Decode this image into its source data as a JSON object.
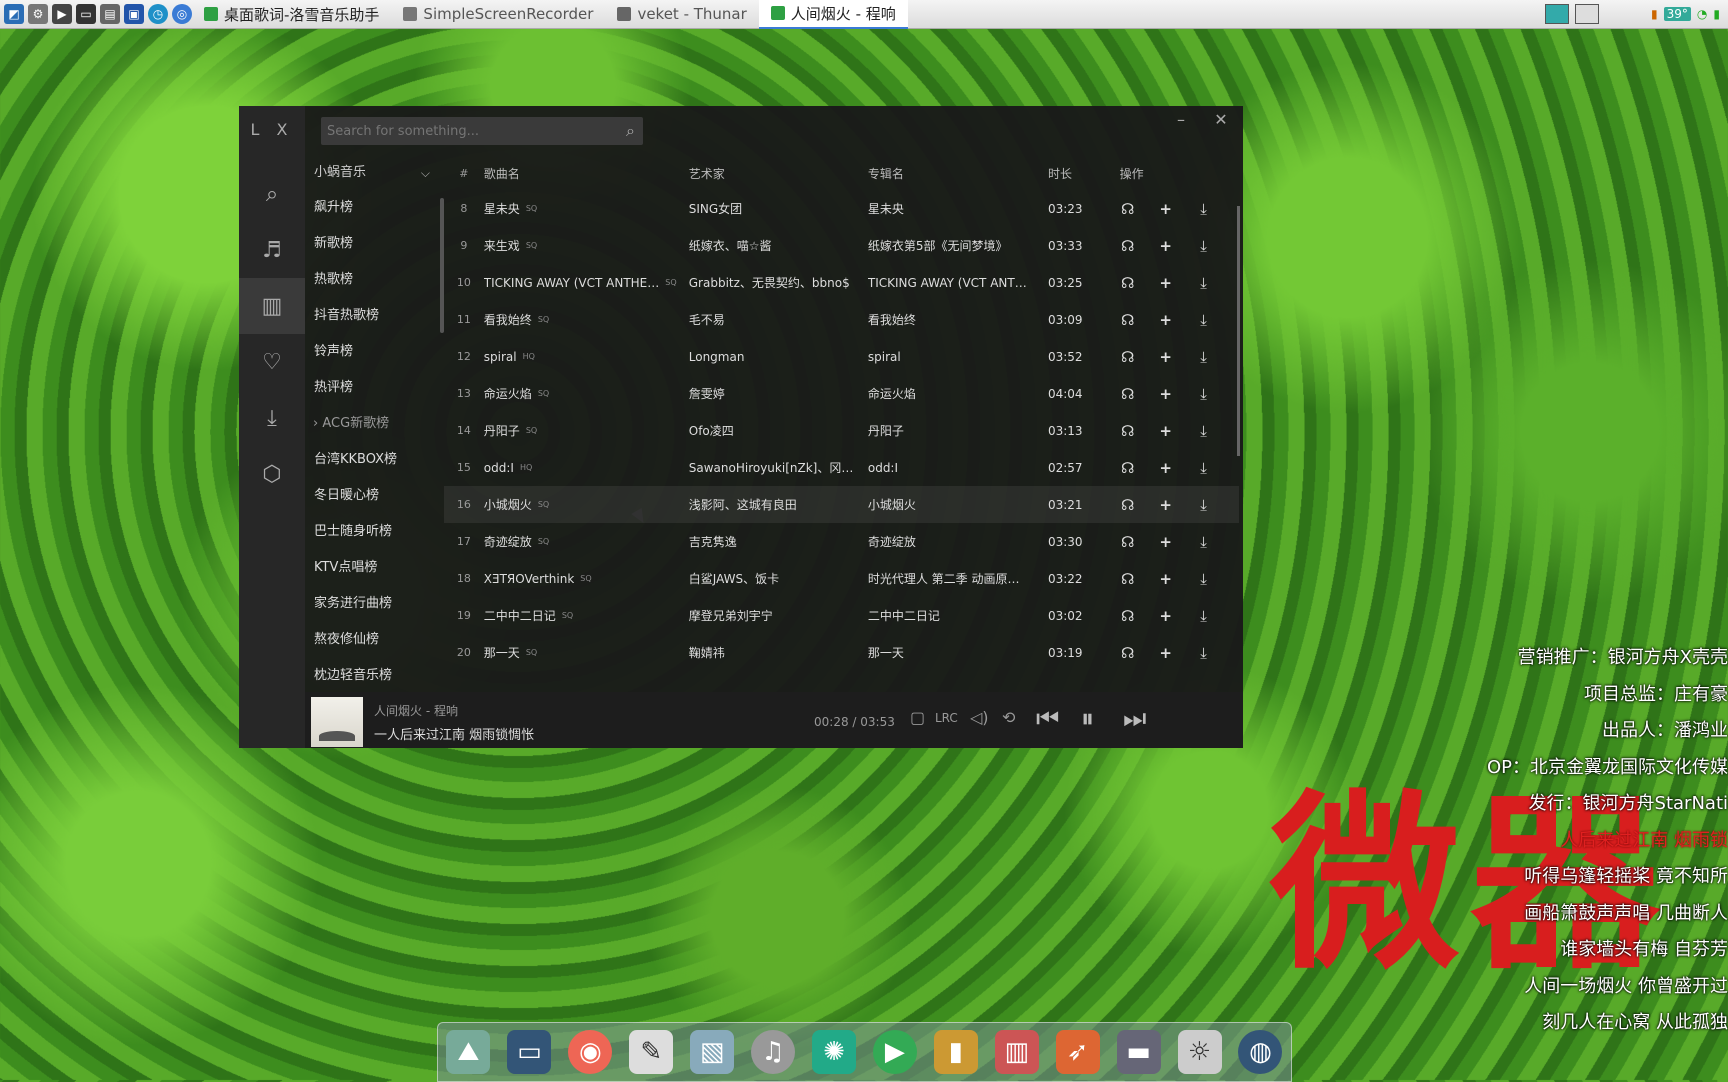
{
  "taskbar": {
    "tasks": [
      {
        "label": "桌面歌词-洛雪音乐助手",
        "color": "#2ea043"
      },
      {
        "label": "SimpleScreenRecorder",
        "color": "#c0392b"
      },
      {
        "label": "veket - Thunar",
        "color": "#555555"
      },
      {
        "label": "人间烟火 - 程响",
        "color": "#2ea043"
      }
    ],
    "temperature": "39°"
  },
  "app": {
    "logo": "L X",
    "search_placeholder": "Search for something...",
    "source": "小蜗音乐",
    "boards": [
      "飙升榜",
      "新歌榜",
      "热歌榜",
      "抖音热歌榜",
      "铃声榜",
      "热评榜",
      "ACG新歌榜",
      "台湾KKBOX榜",
      "冬日暖心榜",
      "巴士随身听榜",
      "KTV点唱榜",
      "家务进行曲榜",
      "熬夜修仙榜",
      "枕边轻音乐榜"
    ],
    "columns": {
      "num": "#",
      "name": "歌曲名",
      "artist": "艺术家",
      "album": "专辑名",
      "duration": "时长",
      "actions": "操作"
    },
    "songs": [
      {
        "num": "8",
        "name": "星未央",
        "quality": "SQ",
        "artist": "SING女团",
        "album": "星未央",
        "duration": "03:23"
      },
      {
        "num": "9",
        "name": "来生戏",
        "quality": "SQ",
        "artist": "纸嫁衣、喵☆酱",
        "album": "纸嫁衣第5部《无间梦境》",
        "duration": "03:33"
      },
      {
        "num": "10",
        "name": "TICKING AWAY (VCT ANTHE…",
        "quality": "SQ",
        "artist": "Grabbitz、无畏契约、bbno$",
        "album": "TICKING AWAY (VCT ANT…",
        "duration": "03:25"
      },
      {
        "num": "11",
        "name": "看我始终",
        "quality": "SQ",
        "artist": "毛不易",
        "album": "看我始终",
        "duration": "03:09"
      },
      {
        "num": "12",
        "name": "spiral",
        "quality": "HQ",
        "artist": "Longman",
        "album": "spiral",
        "duration": "03:52"
      },
      {
        "num": "13",
        "name": "命运火焰",
        "quality": "SQ",
        "artist": "詹雯婷",
        "album": "命运火焰",
        "duration": "04:04"
      },
      {
        "num": "14",
        "name": "丹阳子",
        "quality": "SQ",
        "artist": "Ofo凌四",
        "album": "丹阳子",
        "duration": "03:13"
      },
      {
        "num": "15",
        "name": "odd:I",
        "quality": "HQ",
        "artist": "SawanoHiroyuki[nZk]、冈野…",
        "album": "odd:I",
        "duration": "02:57"
      },
      {
        "num": "16",
        "name": "小城烟火",
        "quality": "SQ",
        "artist": "浅影阿、这城有良田",
        "album": "小城烟火",
        "duration": "03:21"
      },
      {
        "num": "17",
        "name": "奇迹绽放",
        "quality": "SQ",
        "artist": "吉克隽逸",
        "album": "奇迹绽放",
        "duration": "03:30"
      },
      {
        "num": "18",
        "name": "XƎTЯOVerthink",
        "quality": "SQ",
        "artist": "白鲨JAWS、饭卡",
        "album": "时光代理人 第二季 动画原…",
        "duration": "03:22"
      },
      {
        "num": "19",
        "name": "二中中二日记",
        "quality": "SQ",
        "artist": "摩登兄弟刘宇宁",
        "album": "二中中二日记",
        "duration": "03:02"
      },
      {
        "num": "20",
        "name": "那一天",
        "quality": "SQ",
        "artist": "鞠婧祎",
        "album": "那一天",
        "duration": "03:19"
      }
    ],
    "player": {
      "title": "人间烟火 - 程响",
      "lyric": "一人后来过江南 烟雨锁惆怅",
      "time": "00:28 / 03:53",
      "lrc_label": "LRC"
    }
  },
  "overlay": {
    "big_text": "微器",
    "credits": [
      "营销推广：银河方舟X壳壳",
      "项目总监：庄有豪",
      "出品人：潘鸿业",
      "OP：北京金翼龙国际文化传媒",
      "发行：银河方舟StarNati",
      "人后来过江南 烟雨锁",
      "听得乌篷轻摇桨 竟不知所",
      "画船箫鼓声声唱 几曲断人",
      "谁家墙头有梅 自芬芳",
      "人间一场烟火 你曾盛开过",
      "刻几人在心窝 从此孤独"
    ]
  }
}
